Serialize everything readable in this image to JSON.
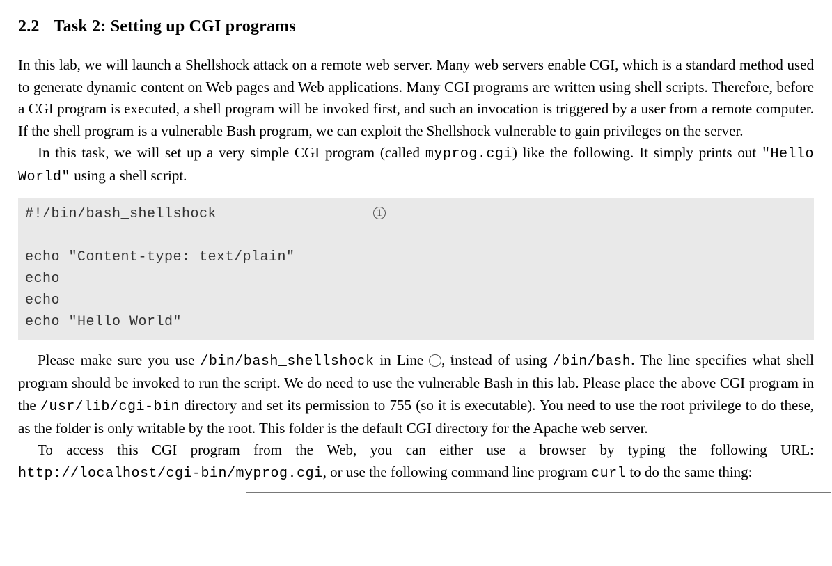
{
  "section": {
    "number": "2.2",
    "title": "Task 2: Setting up CGI programs"
  },
  "para1": "In this lab, we will launch a Shellshock attack on a remote web server.  Many web servers enable CGI, which is a standard method used to generate dynamic content on Web pages and Web applications.  Many CGI programs are written using shell scripts. Therefore, before a CGI program is executed, a shell program will be invoked first, and such an invocation is triggered by a user from a remote computer.  If the shell program is a vulnerable Bash program, we can exploit the Shellshock vulnerable to gain privileges on the server.",
  "para2_pre": "In this task, we will set up a very simple CGI program (called ",
  "para2_cgi": "myprog.cgi",
  "para2_mid": ") like the following.  It simply prints out ",
  "para2_hello": "\"Hello World\"",
  "para2_post": " using a shell script.",
  "code": {
    "l1": "#!/bin/bash_shellshock",
    "marker": "1",
    "l2": "",
    "l3": "echo \"Content-type: text/plain\"",
    "l4": "echo",
    "l5": "echo",
    "l6": "echo \"Hello World\""
  },
  "para3_a": "Please make sure you use ",
  "para3_path1": "/bin/bash_shellshock",
  "para3_b": " in Line ",
  "para3_marker": "1",
  "para3_c": ", instead of using ",
  "para3_path2": "/bin/bash",
  "para3_d": ". The line specifies what shell program should be invoked to run the script.  We do need to use the vulnerable Bash in this lab.  Please place the above CGI program in the ",
  "para3_path3": "/usr/lib/cgi-bin",
  "para3_e": " directory and set its permission to 755 (so it is executable).  You need to use the root privilege to do these, as the folder is only writable by the root. This folder is the default CGI directory for the Apache web server.",
  "para4_a": "To access this CGI program from the Web, you can either use a browser by typing the following URL: ",
  "para4_url": "http://localhost/cgi-bin/myprog.cgi",
  "para4_b": ", or use the following command line program ",
  "para4_curl": "curl",
  "para4_c": " to do the same thing:"
}
